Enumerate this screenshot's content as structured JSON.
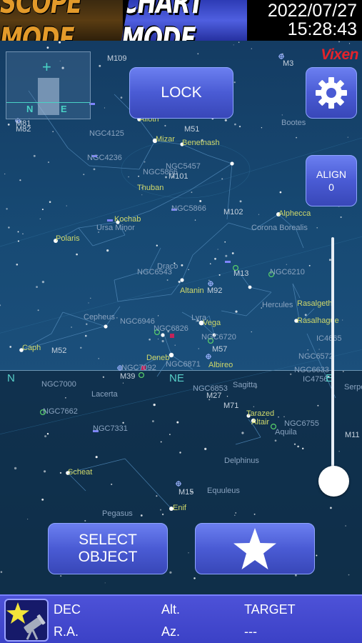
{
  "header": {
    "scope_mode": "SCOPE MODE",
    "chart_mode": "CHART MODE",
    "date": "2022/07/27",
    "time": "15:28:43"
  },
  "brand": "Vixen",
  "buttons": {
    "lock": "LOCK",
    "align_label": "ALIGN",
    "align_value": "0",
    "select_object": "SELECT OBJECT"
  },
  "icons": {
    "settings": "gear-icon",
    "favorite": "star-icon",
    "object": "star-telescope-icon"
  },
  "minimap": {
    "n": "N",
    "e": "E"
  },
  "compass": {
    "n": "N",
    "ne": "NE",
    "e": "E"
  },
  "sky_labels": [
    {
      "text": "M82",
      "cls": "gray"
    },
    {
      "text": "M109",
      "cls": "gray"
    },
    {
      "text": "M81",
      "cls": "gray"
    },
    {
      "text": "M3",
      "cls": "gray"
    },
    {
      "text": "M51",
      "cls": "gray"
    },
    {
      "text": "Alioth",
      "cls": ""
    },
    {
      "text": "Mizar",
      "cls": ""
    },
    {
      "text": "Benetnash",
      "cls": ""
    },
    {
      "text": "Bootes",
      "cls": "dim"
    },
    {
      "text": "NGC4125",
      "cls": "dim"
    },
    {
      "text": "NGC4236",
      "cls": "dim"
    },
    {
      "text": "NGC5457",
      "cls": "dim"
    },
    {
      "text": "NGC5866",
      "cls": "dim"
    },
    {
      "text": "M101",
      "cls": "gray"
    },
    {
      "text": "Thuban",
      "cls": ""
    },
    {
      "text": "NGC5866",
      "cls": "dim"
    },
    {
      "text": "M102",
      "cls": "gray"
    },
    {
      "text": "Alphecca",
      "cls": ""
    },
    {
      "text": "Kochab",
      "cls": ""
    },
    {
      "text": "Ursa Minor",
      "cls": "dim"
    },
    {
      "text": "Corona Borealis",
      "cls": "dim"
    },
    {
      "text": "Polaris",
      "cls": ""
    },
    {
      "text": "Draco",
      "cls": "dim"
    },
    {
      "text": "NGC6543",
      "cls": "dim"
    },
    {
      "text": "M13",
      "cls": "gray"
    },
    {
      "text": "NGC6210",
      "cls": "dim"
    },
    {
      "text": "Altanin",
      "cls": ""
    },
    {
      "text": "M92",
      "cls": "gray"
    },
    {
      "text": "Rasalgethi",
      "cls": ""
    },
    {
      "text": "Hercules",
      "cls": "dim"
    },
    {
      "text": "Cepheus",
      "cls": "dim"
    },
    {
      "text": "Rasalhague",
      "cls": ""
    },
    {
      "text": "NGC6946",
      "cls": "dim"
    },
    {
      "text": "Lyra",
      "cls": "dim"
    },
    {
      "text": "Vega",
      "cls": ""
    },
    {
      "text": "NGC6826",
      "cls": "dim"
    },
    {
      "text": "NGC6720",
      "cls": "dim"
    },
    {
      "text": "IC4665",
      "cls": "dim"
    },
    {
      "text": "Caph",
      "cls": ""
    },
    {
      "text": "M52",
      "cls": "gray"
    },
    {
      "text": "M57",
      "cls": "gray"
    },
    {
      "text": "Deneb",
      "cls": ""
    },
    {
      "text": "NGC6572",
      "cls": "dim"
    },
    {
      "text": "NGC7092",
      "cls": "dim"
    },
    {
      "text": "NGC6871",
      "cls": "dim"
    },
    {
      "text": "Albireo",
      "cls": ""
    },
    {
      "text": "NGC6633",
      "cls": "dim"
    },
    {
      "text": "M39",
      "cls": "gray"
    },
    {
      "text": "IC4756",
      "cls": "dim"
    },
    {
      "text": "NGC7000",
      "cls": "dim"
    },
    {
      "text": "NGC6853",
      "cls": "dim"
    },
    {
      "text": "Sagitta",
      "cls": "dim"
    },
    {
      "text": "Serpens",
      "cls": "dim"
    },
    {
      "text": "Lacerta",
      "cls": "dim"
    },
    {
      "text": "M27",
      "cls": "gray"
    },
    {
      "text": "M71",
      "cls": "gray"
    },
    {
      "text": "NGC7662",
      "cls": "dim"
    },
    {
      "text": "Tarazed",
      "cls": ""
    },
    {
      "text": "Altair",
      "cls": ""
    },
    {
      "text": "NGC6755",
      "cls": "dim"
    },
    {
      "text": "Aquila",
      "cls": "dim"
    },
    {
      "text": "M11",
      "cls": "gray"
    },
    {
      "text": "NGC7331",
      "cls": "dim"
    },
    {
      "text": "Delphinus",
      "cls": "dim"
    },
    {
      "text": "Scheat",
      "cls": ""
    },
    {
      "text": "M15",
      "cls": "gray"
    },
    {
      "text": "Equuleus",
      "cls": "dim"
    },
    {
      "text": "Pegasus",
      "cls": "dim"
    },
    {
      "text": "Enif",
      "cls": ""
    }
  ],
  "info": {
    "dec_label": "DEC",
    "ra_label": "R.A.",
    "alt_label": "Alt.",
    "az_label": "Az.",
    "target_label": "TARGET",
    "target_value": "---"
  }
}
